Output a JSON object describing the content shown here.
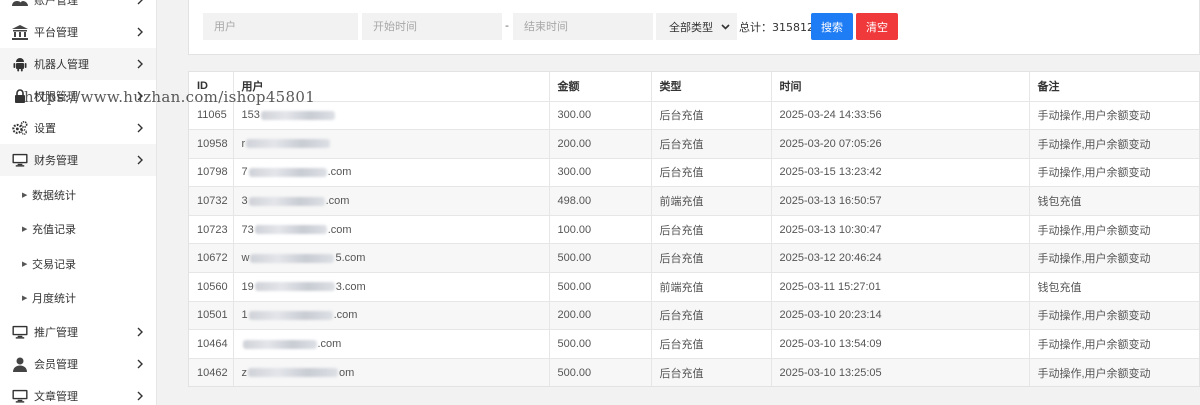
{
  "sidebar": {
    "items": [
      {
        "label": "账户管理",
        "icon": "users-icon"
      },
      {
        "label": "平台管理",
        "icon": "bank-icon"
      },
      {
        "label": "机器人管理",
        "icon": "android-icon"
      },
      {
        "label": "权限管理",
        "icon": "lock-icon"
      },
      {
        "label": "设置",
        "icon": "gears-icon"
      },
      {
        "label": "财务管理",
        "icon": "monitor-icon"
      }
    ],
    "submenu": [
      {
        "label": "数据统计"
      },
      {
        "label": "充值记录"
      },
      {
        "label": "交易记录"
      },
      {
        "label": "月度统计"
      }
    ],
    "bottom_items": [
      {
        "label": "推广管理",
        "icon": "monitor-icon"
      },
      {
        "label": "会员管理",
        "icon": "user-icon"
      },
      {
        "label": "文章管理",
        "icon": "monitor-icon"
      }
    ]
  },
  "filters": {
    "user_placeholder": "用户",
    "start_placeholder": "开始时间",
    "dash": "-",
    "end_placeholder": "结束时间",
    "type_select": "全部类型",
    "total_text": "总计：315812",
    "search_label": "搜索",
    "clear_label": "清空"
  },
  "colors": {
    "search_button": "#1e7cf5",
    "clear_button": "#f0393b"
  },
  "table": {
    "headers": [
      "ID",
      "用户",
      "金额",
      "类型",
      "时间",
      "备注"
    ],
    "rows": [
      {
        "id": "11065",
        "user_prefix": "153",
        "user_suffix": "",
        "amount": "300.00",
        "type": "后台充值",
        "time": "2025-03-24 14:33:56",
        "note": "手动操作,用户余额变动"
      },
      {
        "id": "10958",
        "user_prefix": "r",
        "user_suffix": "",
        "amount": "200.00",
        "type": "后台充值",
        "time": "2025-03-20 07:05:26",
        "note": "手动操作,用户余额变动"
      },
      {
        "id": "10798",
        "user_prefix": "7",
        "user_suffix": ".com",
        "amount": "300.00",
        "type": "后台充值",
        "time": "2025-03-15 13:23:42",
        "note": "手动操作,用户余额变动"
      },
      {
        "id": "10732",
        "user_prefix": "3",
        "user_suffix": ".com",
        "amount": "498.00",
        "type": "前端充值",
        "time": "2025-03-13 16:50:57",
        "note": "钱包充值"
      },
      {
        "id": "10723",
        "user_prefix": "73",
        "user_suffix": ".com",
        "amount": "100.00",
        "type": "后台充值",
        "time": "2025-03-13 10:30:47",
        "note": "手动操作,用户余额变动"
      },
      {
        "id": "10672",
        "user_prefix": "w",
        "user_suffix": "5.com",
        "amount": "500.00",
        "type": "后台充值",
        "time": "2025-03-12 20:46:24",
        "note": "手动操作,用户余额变动"
      },
      {
        "id": "10560",
        "user_prefix": "19",
        "user_suffix": "3.com",
        "amount": "500.00",
        "type": "前端充值",
        "time": "2025-03-11 15:27:01",
        "note": "钱包充值"
      },
      {
        "id": "10501",
        "user_prefix": "1",
        "user_suffix": ".com",
        "amount": "200.00",
        "type": "后台充值",
        "time": "2025-03-10 20:23:14",
        "note": "手动操作,用户余额变动"
      },
      {
        "id": "10464",
        "user_prefix": "",
        "user_suffix": ".com",
        "amount": "500.00",
        "type": "后台充值",
        "time": "2025-03-10 13:54:09",
        "note": "手动操作,用户余额变动"
      },
      {
        "id": "10462",
        "user_prefix": "z",
        "user_suffix": "om",
        "amount": "500.00",
        "type": "后台充值",
        "time": "2025-03-10 13:25:05",
        "note": "手动操作,用户余额变动"
      }
    ]
  },
  "watermark": "https://www.huzhan.com/ishop45801"
}
